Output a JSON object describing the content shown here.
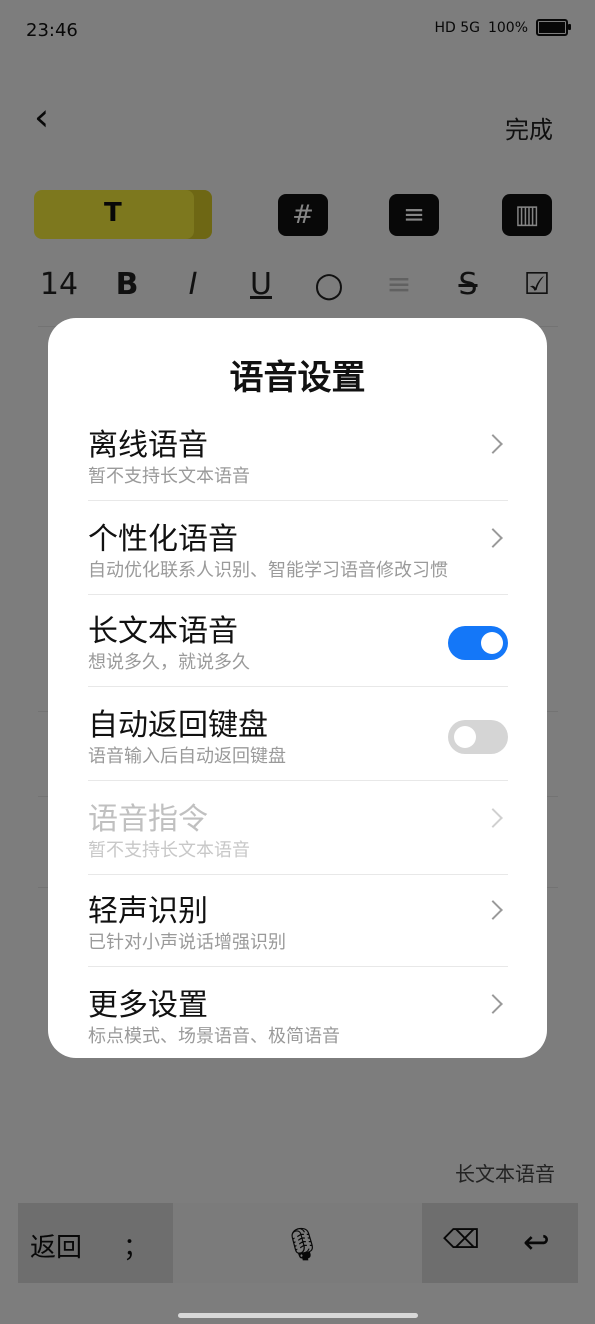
{
  "status_bar": {
    "time": "23:46",
    "network": "HD 5G",
    "battery": "100%"
  },
  "toolbar": {
    "done": "完成"
  },
  "style_tabs": {
    "text_style": "T"
  },
  "format": {
    "font_size": "14",
    "bold": "B",
    "italic": "I",
    "underline": "U",
    "strikethrough": "S"
  },
  "voice_hint": "长文本语音",
  "keyboard": {
    "back": "返回",
    "punct": "；"
  },
  "dialog": {
    "title": "语音设置",
    "items": [
      {
        "title": "离线语音",
        "subtitle": "暂不支持长文本语音"
      },
      {
        "title": "个性化语音",
        "subtitle": "自动优化联系人识别、智能学习语音修改习惯"
      },
      {
        "title": "长文本语音",
        "subtitle": "想说多久，就说多久"
      },
      {
        "title": "自动返回键盘",
        "subtitle": "语音输入后自动返回键盘"
      },
      {
        "title": "语音指令",
        "subtitle": "暂不支持长文本语音"
      },
      {
        "title": "轻声识别",
        "subtitle": "已针对小声说话增强识别"
      },
      {
        "title": "更多设置",
        "subtitle": "标点模式、场景语音、极简语音"
      }
    ],
    "long_text_voice_enabled": true,
    "auto_return_keyboard_enabled": false
  },
  "colors": {
    "accent": "#1477f8",
    "switch_off": "#d5d5d5",
    "dim_overlay": "#777777"
  }
}
